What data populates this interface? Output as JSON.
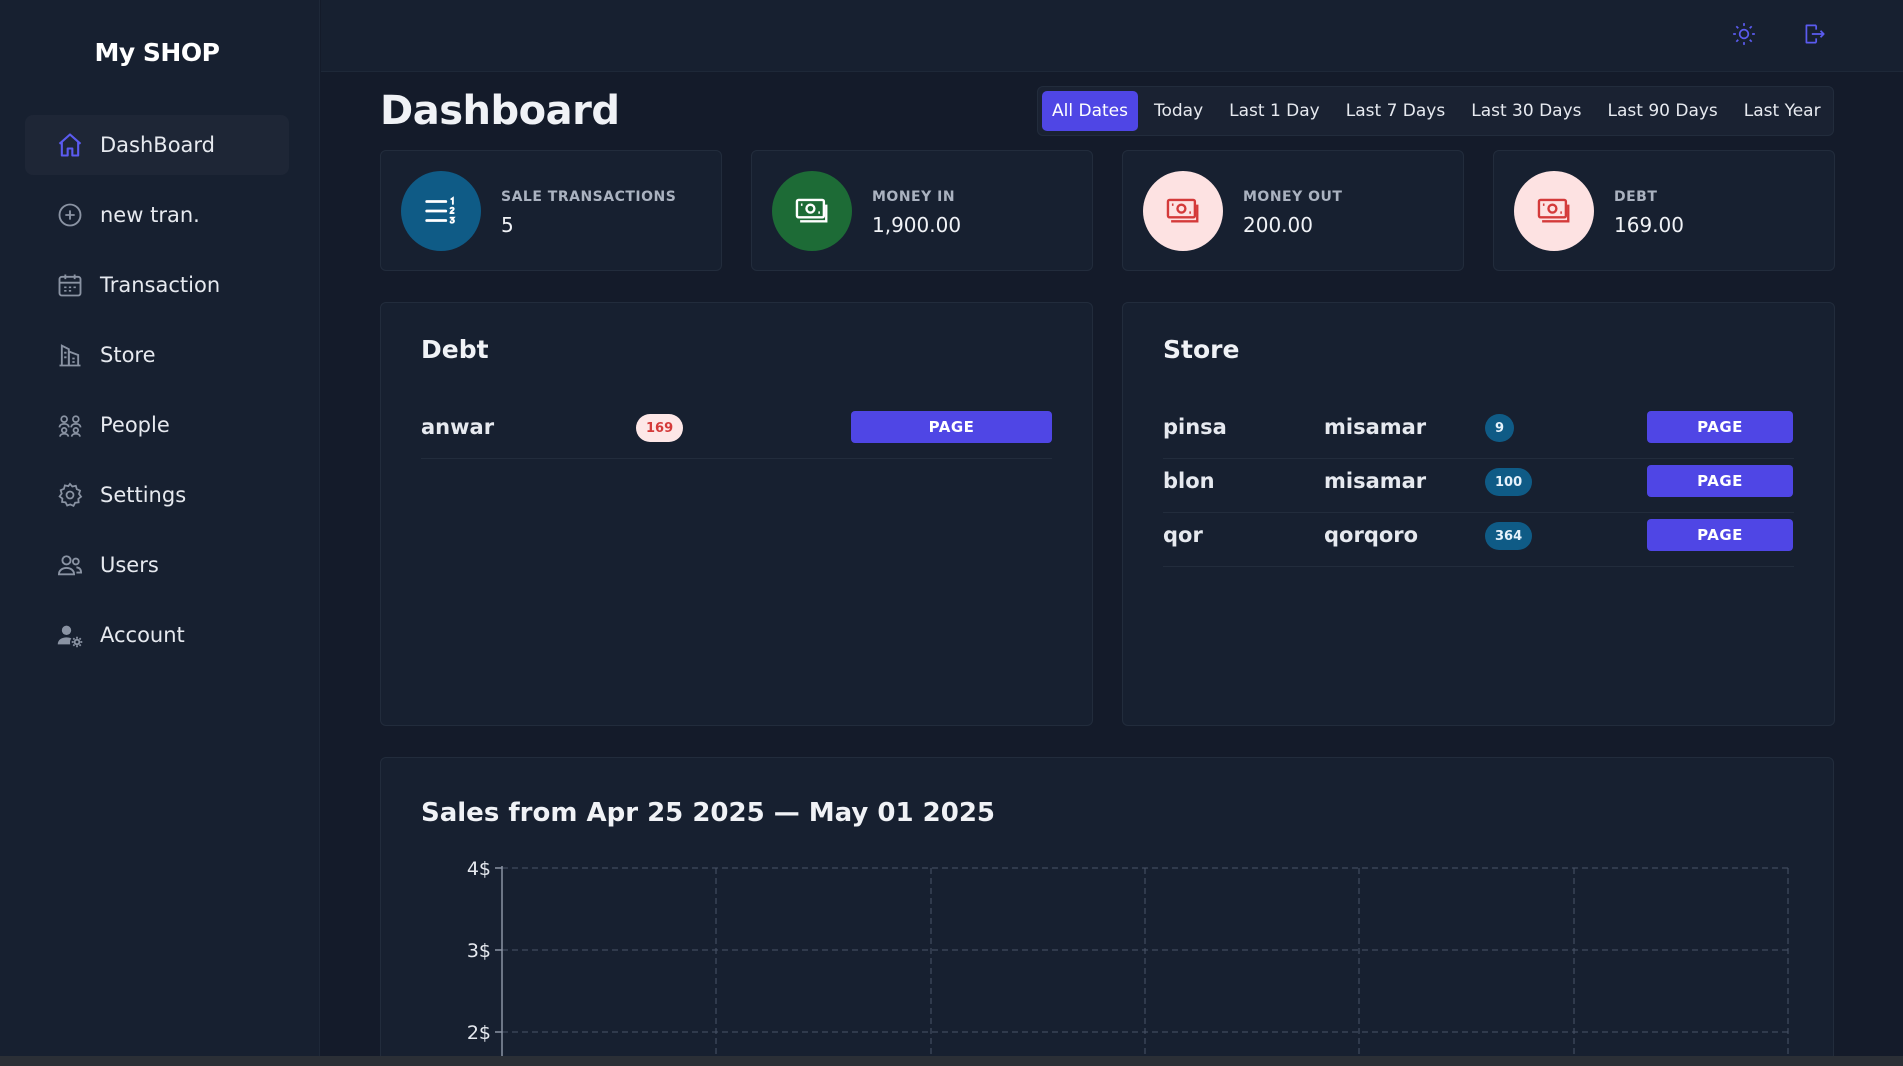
{
  "brand": "My SHOP",
  "sidebar": {
    "items": [
      {
        "label": "DashBoard",
        "icon": "home-icon",
        "active": true
      },
      {
        "label": "new tran.",
        "icon": "plus-circle-icon"
      },
      {
        "label": "Transaction",
        "icon": "calendar-icon"
      },
      {
        "label": "Store",
        "icon": "building-icon"
      },
      {
        "label": "People",
        "icon": "people-icon"
      },
      {
        "label": "Settings",
        "icon": "gear-icon"
      },
      {
        "label": "Users",
        "icon": "users-icon"
      },
      {
        "label": "Account",
        "icon": "user-settings-icon"
      }
    ]
  },
  "topbar": {
    "theme_icon": "sun-icon",
    "logout_icon": "logout-icon"
  },
  "page": {
    "title": "Dashboard"
  },
  "ranges": [
    "All Dates",
    "Today",
    "Last 1 Day",
    "Last 7 Days",
    "Last 30 Days",
    "Last 90 Days",
    "Last Year"
  ],
  "active_range": "All Dates",
  "stats": [
    {
      "label": "SALE TRANSACTIONS",
      "value": "5",
      "icon": "numbered-list-icon",
      "color": "#0f5b86"
    },
    {
      "label": "MONEY IN",
      "value": "1,900.00",
      "icon": "money-icon",
      "color": "#1d6b36"
    },
    {
      "label": "MONEY OUT",
      "value": "200.00",
      "icon": "money-icon",
      "color": "#fde2e2"
    },
    {
      "label": "DEBT",
      "value": "169.00",
      "icon": "money-icon",
      "color": "#fde2e2"
    }
  ],
  "debt": {
    "title": "Debt",
    "rows": [
      {
        "name": "anwar",
        "amount": "169",
        "button": "PAGE"
      }
    ]
  },
  "store": {
    "title": "Store",
    "rows": [
      {
        "item": "pinsa",
        "owner": "misamar",
        "count": "9",
        "button": "PAGE"
      },
      {
        "item": "blon",
        "owner": "misamar",
        "count": "100",
        "button": "PAGE"
      },
      {
        "item": "qor",
        "owner": "qorqoro",
        "count": "364",
        "button": "PAGE"
      }
    ]
  },
  "sales": {
    "title": "Sales from Apr 25 2025 — May 01 2025",
    "y_ticks": [
      "4$",
      "3$",
      "2$"
    ]
  },
  "colors": {
    "accent": "#4f46e5",
    "background": "#141b2a",
    "panel": "#172030"
  }
}
